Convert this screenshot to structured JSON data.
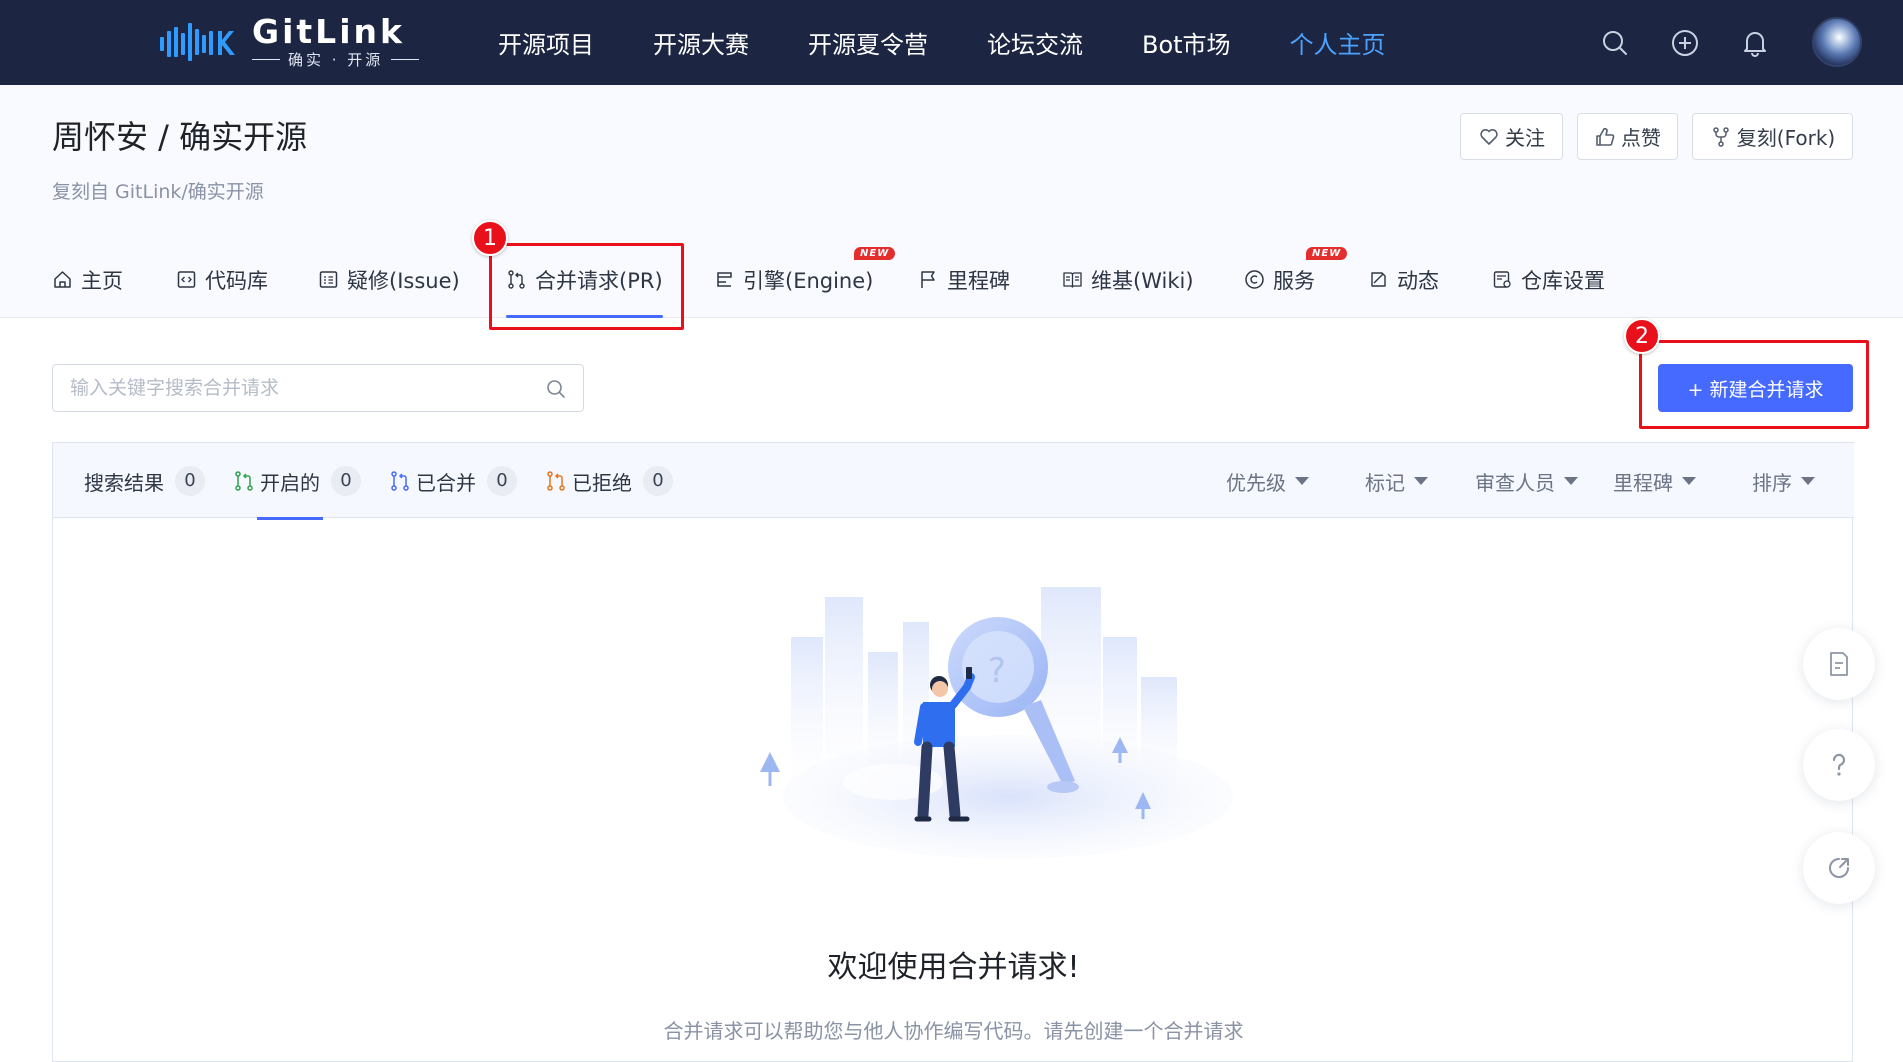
{
  "topnav": {
    "logo": {
      "name": "GitLink",
      "subtitle": "确实 · 开源"
    },
    "items": [
      {
        "label": "开源项目",
        "active": false
      },
      {
        "label": "开源大赛",
        "active": false
      },
      {
        "label": "开源夏令营",
        "active": false
      },
      {
        "label": "论坛交流",
        "active": false
      },
      {
        "label": "Bot市场",
        "active": false
      },
      {
        "label": "个人主页",
        "active": true
      }
    ],
    "icons": [
      "search-icon",
      "plus-circle-icon",
      "bell-icon",
      "avatar"
    ]
  },
  "repo": {
    "title": "周怀安 / 确实开源",
    "forked_from": "复刻自 GitLink/确实开源",
    "actions": {
      "watch": "关注",
      "like": "点赞",
      "fork": "复刻(Fork)"
    }
  },
  "tabs": [
    {
      "label": "主页",
      "icon": "home-icon"
    },
    {
      "label": "代码库",
      "icon": "code-icon"
    },
    {
      "label": "疑修(Issue)",
      "icon": "issue-icon"
    },
    {
      "label": "合并请求(PR)",
      "icon": "pull-request-icon",
      "active": true
    },
    {
      "label": "引擎(Engine)",
      "icon": "engine-icon",
      "badge": "NEW"
    },
    {
      "label": "里程碑",
      "icon": "flag-icon"
    },
    {
      "label": "维基(Wiki)",
      "icon": "book-icon"
    },
    {
      "label": "服务",
      "icon": "service-icon",
      "badge": "NEW"
    },
    {
      "label": "动态",
      "icon": "activity-icon"
    },
    {
      "label": "仓库设置",
      "icon": "settings-icon"
    }
  ],
  "search": {
    "placeholder": "输入关键字搜索合并请求"
  },
  "new_pr_button": "+ 新建合并请求",
  "filters": {
    "results": {
      "label": "搜索结果",
      "count": "0"
    },
    "open": {
      "label": "开启的",
      "count": "0"
    },
    "merged": {
      "label": "已合并",
      "count": "0"
    },
    "rejected": {
      "label": "已拒绝",
      "count": "0"
    }
  },
  "dropdowns": [
    "优先级",
    "标记",
    "审查人员",
    "里程碑",
    "排序"
  ],
  "empty_state": {
    "title": "欢迎使用合并请求!",
    "description": "合并请求可以帮助您与他人协作编写代码。请先创建一个合并请求"
  },
  "callouts": [
    "1",
    "2"
  ],
  "colors": {
    "navbar": "#1c2541",
    "accent": "#466aff",
    "active_nav": "#4ca3ff",
    "callout": "#e8111b"
  }
}
